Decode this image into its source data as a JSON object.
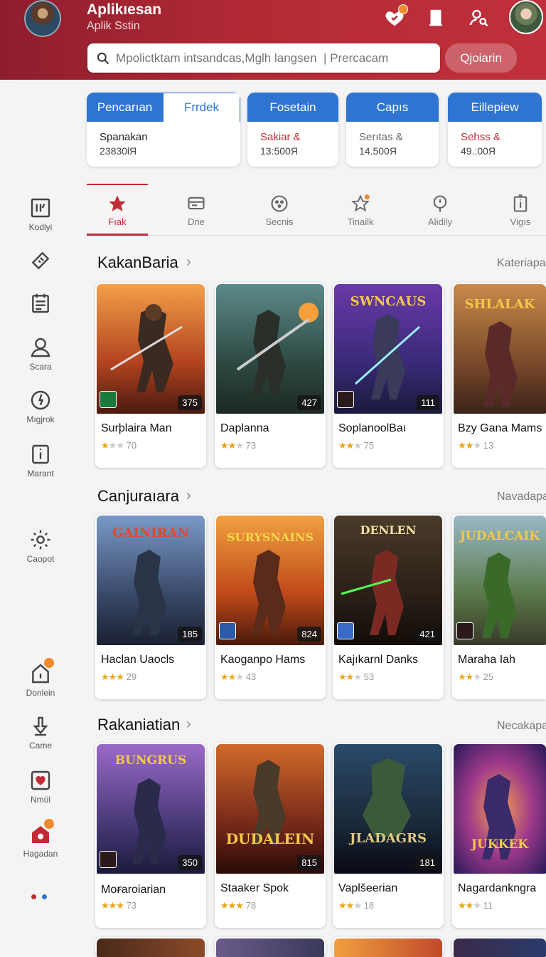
{
  "header": {
    "title": "Aplikıesan",
    "subtitle": "Aplik Sstin",
    "search_placeholder": "Mpolictktam intsandcas,Mglh langsen  | Prercacam",
    "search_button": "Qjoiarin",
    "colors": {
      "brand": "#b22a36",
      "accent": "#2f74d0"
    }
  },
  "categories": [
    {
      "tab_a": "Pencarıan",
      "tab_b": "Frrdek",
      "line1": "Spanakan",
      "line2": "23830lЯ",
      "color": "#222"
    },
    {
      "head": "Fosetain",
      "line1": "Sakiar &",
      "line2": "13:500Я",
      "color": "#c22b36"
    },
    {
      "head": "Capıs",
      "line1": "Serıtas &",
      "line2": "14.500Я",
      "color": "#666"
    },
    {
      "head": "Eillepiew",
      "line1": "Sehss &",
      "line2": "49.:00Я",
      "color": "#c22b36"
    }
  ],
  "tabs": [
    {
      "label": "Fıak",
      "icon": "star-icon"
    },
    {
      "label": "Dne",
      "icon": "card-icon"
    },
    {
      "label": "Secnis",
      "icon": "gamepad-icon"
    },
    {
      "label": "Tinailk",
      "icon": "badge-star-icon"
    },
    {
      "label": "Alidily",
      "icon": "location-icon"
    },
    {
      "label": "Vigıs",
      "icon": "info-icon"
    }
  ],
  "sidebar": [
    {
      "label": "Kodlyi",
      "icon": "grid-icon"
    },
    {
      "label": "",
      "icon": "ticket-icon"
    },
    {
      "label": "",
      "icon": "calendar-icon"
    },
    {
      "label": "Scara",
      "icon": "user-icon"
    },
    {
      "label": "Mıgjrok",
      "icon": "clock-icon"
    },
    {
      "label": "Marant",
      "icon": "info-box-icon"
    },
    {
      "label": "Caopot",
      "icon": "gear-icon"
    },
    {
      "label": "Donlein",
      "icon": "home-icon"
    },
    {
      "label": "Came",
      "icon": "download-icon"
    },
    {
      "label": "Nmül",
      "icon": "heart-icon"
    },
    {
      "label": "Hagadan",
      "icon": "shop-icon"
    }
  ],
  "sections": [
    {
      "title": "KakanBaria",
      "more": "Kateriapa",
      "games": [
        {
          "name": "Surþlaira Man",
          "num": "375",
          "rating": "70",
          "stars": 1,
          "art_text": ""
        },
        {
          "name": "Daplanna",
          "num": "427",
          "rating": "73",
          "stars": 2,
          "art_text": ""
        },
        {
          "name": "SoplanoolBaı",
          "num": "111",
          "rating": "75",
          "stars": 2,
          "art_text": "SWNCAUS"
        },
        {
          "name": "Bzy Gana Mams",
          "num": "",
          "rating": "13",
          "stars": 2,
          "art_text": "SHLALAK"
        }
      ]
    },
    {
      "title": "Canjuraıara",
      "more": "Navadapa",
      "games": [
        {
          "name": "Haclan Uaocls",
          "num": "185",
          "rating": "29",
          "stars": 3,
          "art_text": "GAINIRAN"
        },
        {
          "name": "Kaoganpo Hams",
          "num": "824",
          "rating": "43",
          "stars": 2,
          "art_text": "SURYSNAINS"
        },
        {
          "name": "Kajıkarnl Danks",
          "num": "421",
          "rating": "53",
          "stars": 2,
          "art_text": "DENLEN"
        },
        {
          "name": "Maraha Iah",
          "num": "",
          "rating": "25",
          "stars": 2,
          "art_text": "JUDALCAIK"
        }
      ]
    },
    {
      "title": "Rakaniatian",
      "more": "Necakapa",
      "games": [
        {
          "name": "Moꞧaroiarian",
          "num": "350",
          "rating": "73",
          "stars": 3,
          "art_text": "BUNGRUS"
        },
        {
          "name": "Staaker Spok",
          "num": "815",
          "rating": "78",
          "stars": 3,
          "art_text": "DUDALEIN"
        },
        {
          "name": "Vaplšeerian",
          "num": "181",
          "rating": "18",
          "stars": 2,
          "art_text": "JLADAGRS"
        },
        {
          "name": "Nagardankngra",
          "num": "",
          "rating": "11",
          "stars": 2,
          "art_text": "JUKKEK"
        }
      ]
    }
  ]
}
